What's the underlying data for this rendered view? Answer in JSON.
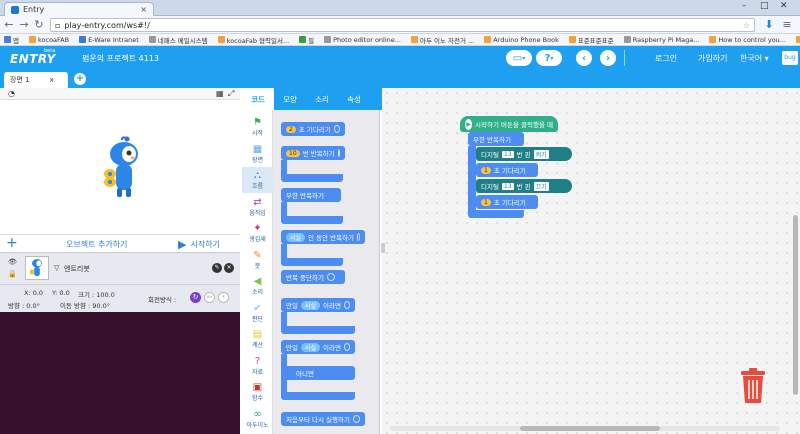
{
  "browser": {
    "tab_title": "Entry",
    "url": "play-entry.com/ws#!/",
    "bookmarks": [
      {
        "label": "앱",
        "color": "#4a7bd8"
      },
      {
        "label": "kocoaFAB",
        "color": "#f4a23a"
      },
      {
        "label": "E-Ware Intranet",
        "color": "#3a7bd8"
      },
      {
        "label": "네패스 메일시스템",
        "color": "#999999"
      },
      {
        "label": "kocoaFab 협력일서...",
        "color": "#f4a23a"
      },
      {
        "label": "필",
        "color": "#3a9d3a"
      },
      {
        "label": "Photo editor online...",
        "color": "#999999"
      },
      {
        "label": "아두 이노 자전거 ...",
        "color": "#f4a23a"
      },
      {
        "label": "Arduino Phone Book",
        "color": "#f4a23a"
      },
      {
        "label": "표준표준표준",
        "color": "#f4a23a"
      },
      {
        "label": "Raspberry Pi Maga...",
        "color": "#999999"
      },
      {
        "label": "How to control you...",
        "color": "#f4a23a"
      },
      {
        "label": "기타 북마크",
        "color": "#f4a23a"
      }
    ]
  },
  "header": {
    "logo": "ENTRY",
    "beta": "beta",
    "project_name": "펌운의 프로젝트 4113",
    "login": "로그인",
    "signup": "가입하기",
    "language": "한국어",
    "user": "bug"
  },
  "scene": {
    "tab_label": "장면 1",
    "tab_close": "x",
    "add": "+"
  },
  "stage": {
    "add_object": "오브젝트 추가하기",
    "start": "시작하기"
  },
  "object": {
    "name": "엔트리봇",
    "x": "X: 0.0",
    "y": "Y: 0.0",
    "size": "크기 : 100.0",
    "direction": "방향 : 0.0°",
    "move_direction": "이동 방향 : 90.0°",
    "rotation_label": "회전방식 :"
  },
  "palette_tabs": [
    {
      "label": "코드",
      "active": true
    },
    {
      "label": "모양",
      "active": false
    },
    {
      "label": "소리",
      "active": false
    },
    {
      "label": "속성",
      "active": false
    }
  ],
  "categories": [
    {
      "label": "시작",
      "color": "#4caf50"
    },
    {
      "label": "장면",
      "color": "#5ea8e8"
    },
    {
      "label": "흐름",
      "color": "#3a76d6"
    },
    {
      "label": "움직임",
      "color": "#a24ccf"
    },
    {
      "label": "생김새",
      "color": "#e2296d"
    },
    {
      "label": "붓",
      "color": "#f08a2b"
    },
    {
      "label": "소리",
      "color": "#7ac943"
    },
    {
      "label": "판단",
      "color": "#a0c8ef"
    },
    {
      "label": "계산",
      "color": "#e8c53a"
    },
    {
      "label": "자료",
      "color": "#d63aa7"
    },
    {
      "label": "함수",
      "color": "#c0392b"
    },
    {
      "label": "아두이노",
      "color": "#26a69a"
    }
  ],
  "palette_blocks": {
    "wait_num": "2",
    "wait_text": "초 기다리기",
    "repeat_num": "10",
    "repeat_text": "번 반복하기",
    "forever": "무한 반복하기",
    "repeat_while_bool": "사실",
    "repeat_while_text": "인 동안 반복하기",
    "stop_repeat": "반복 중단하기",
    "if1_prefix": "만일",
    "if1_bool": "사실",
    "if1_suffix": "이라면",
    "if2_prefix": "만일",
    "if2_bool": "사실",
    "if2_suffix": "이라면",
    "else": "아니면",
    "restart": "처음부터 다시 실행하기"
  },
  "workspace_blocks": {
    "hat": "시작하기 버튼을 클릭했을 때",
    "forever": "무한 반복하기",
    "digital1_prefix": "디지털",
    "digital1_pin": "13",
    "digital1_mid": "번 핀",
    "digital1_value": "켜기",
    "wait1_num": "1",
    "wait1_text": "초 기다리기",
    "digital2_prefix": "디지털",
    "digital2_pin": "13",
    "digital2_mid": "번 핀",
    "digital2_value": "끄기",
    "wait2_num": "1",
    "wait2_text": "초 기다리기"
  }
}
